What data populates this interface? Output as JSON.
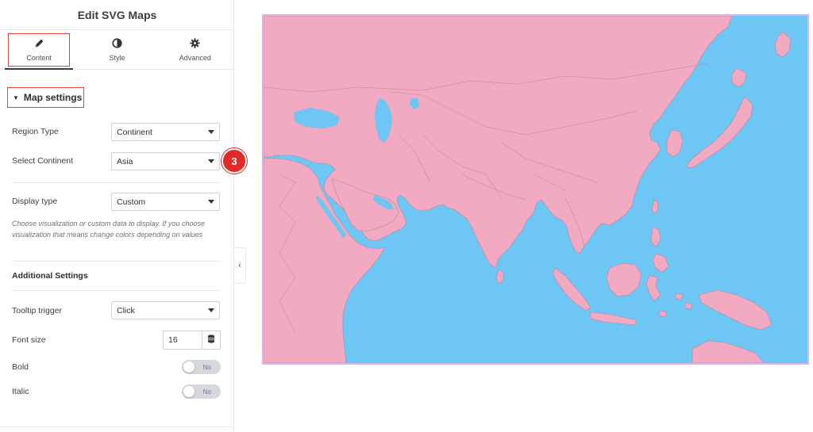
{
  "panel": {
    "title": "Edit SVG Maps",
    "tabs": [
      {
        "label": "Content",
        "icon": "pencil-icon",
        "active": true
      },
      {
        "label": "Style",
        "icon": "contrast-icon",
        "active": false
      },
      {
        "label": "Advanced",
        "icon": "gear-icon",
        "active": false
      }
    ],
    "section_title": "Map settings",
    "fields": {
      "region_type": {
        "label": "Region Type",
        "value": "Continent"
      },
      "select_continent": {
        "label": "Select Continent",
        "value": "Asia"
      },
      "display_type": {
        "label": "Display type",
        "value": "Custom"
      },
      "display_help": "Choose visualization or custom data to display. If you choose visualization that means change colors depending on values",
      "additional_heading": "Additional Settings",
      "tooltip_trigger": {
        "label": "Tooltip trigger",
        "value": "Click"
      },
      "font_size": {
        "label": "Font size",
        "value": "16"
      },
      "bold": {
        "label": "Bold",
        "value": "No"
      },
      "italic": {
        "label": "Italic",
        "value": "No"
      }
    },
    "step_badge": "3"
  },
  "map": {
    "region": "Asia",
    "land_color": "#f2a9c2",
    "water_color": "#6ec6f5",
    "border_color": "#d7b4f0"
  }
}
